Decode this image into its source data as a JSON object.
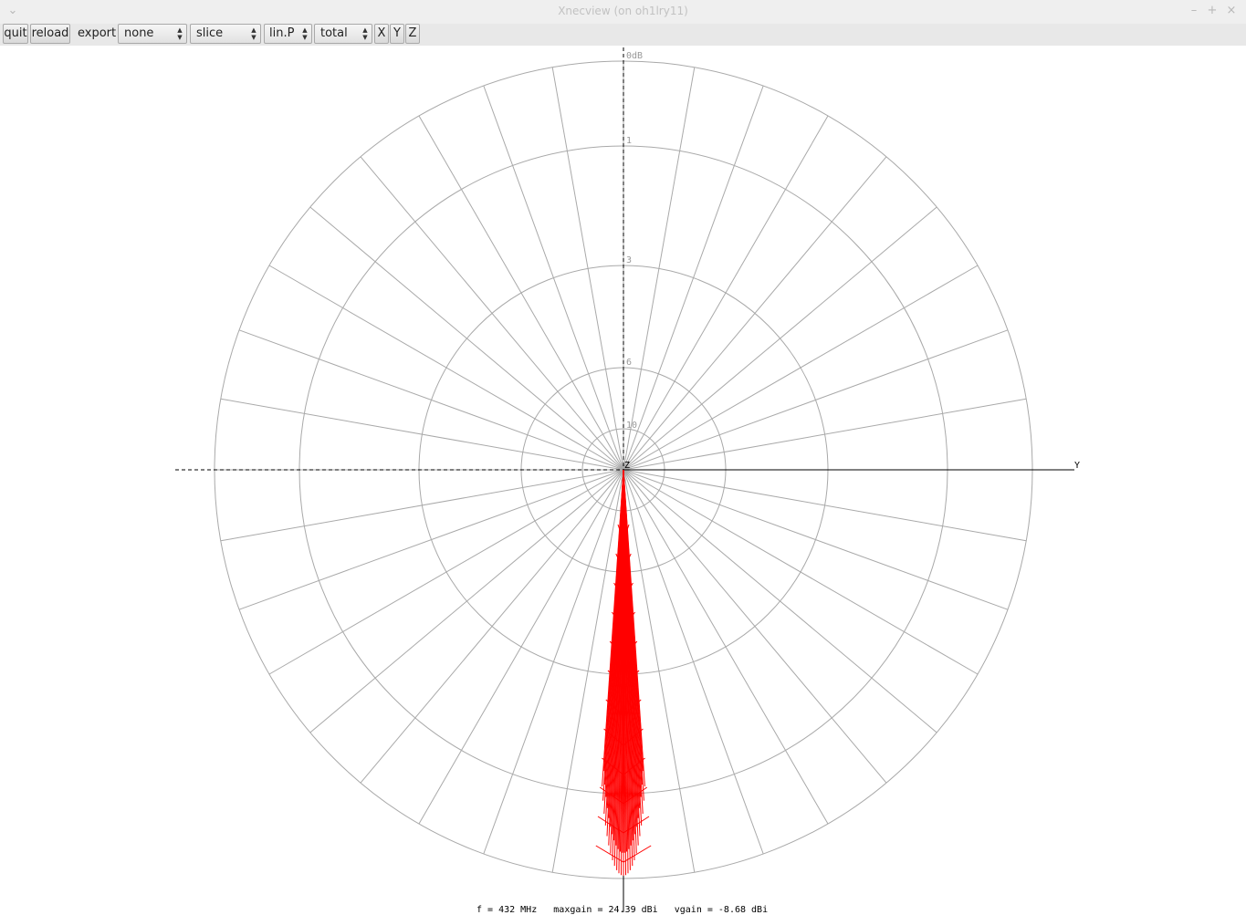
{
  "window": {
    "title": "Xnecview (on oh1lry11)"
  },
  "toolbar": {
    "quit": "quit",
    "reload": "reload",
    "export_label": "export",
    "export_value": "none",
    "view_value": "slice",
    "scale_value": "lin.P",
    "polarization_value": "total",
    "axis_x": "X",
    "axis_y": "Y",
    "axis_z": "Z"
  },
  "plot": {
    "ring_labels": [
      "0dB",
      "1",
      "3",
      "6",
      "10"
    ],
    "axis_label_y": "Y",
    "axis_label_z": "Z",
    "status": "f = 432 MHz   maxgain = 24.39 dBi   vgain = -8.68 dBi",
    "grid_color": "#a9a9a9",
    "pattern_color": "#ff0000"
  }
}
